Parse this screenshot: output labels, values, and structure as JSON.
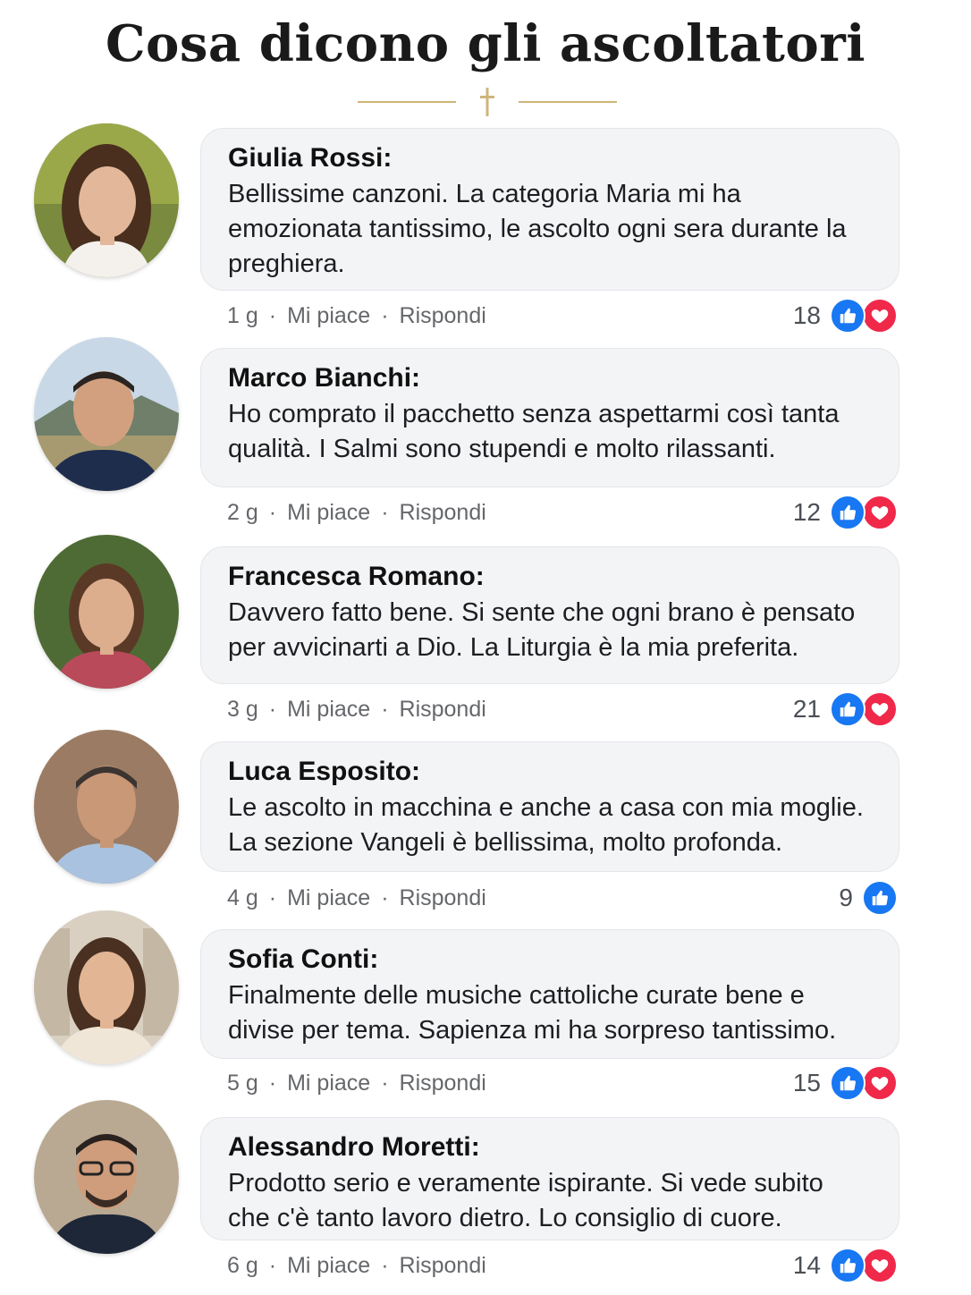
{
  "header": {
    "title": "Cosa dicono gli ascoltatori"
  },
  "colors": {
    "accent_gold": "#cfb57a",
    "like_blue": "#1877f2",
    "love_red": "#f02849",
    "bubble_bg": "#f3f4f6",
    "meta_gray": "#65676b"
  },
  "icons": {
    "divider": "cross-icon",
    "like": "thumbs-up-icon",
    "love": "heart-icon"
  },
  "meta_labels": {
    "like": "Mi piace",
    "reply": "Rispondi",
    "separator": "·"
  },
  "comments": [
    {
      "author": "Giulia Rossi:",
      "text": "Bellissime canzoni. La categoria Maria mi ha emozionata tantissimo, le ascolto ogni sera durante la preghiera.",
      "time": "1 g",
      "count": "18",
      "reactions": [
        "like",
        "love"
      ]
    },
    {
      "author": "Marco Bianchi:",
      "text": "Ho comprato il pacchetto senza aspettarmi così tanta qualità. I Salmi sono stupendi e molto rilassanti.",
      "time": "2 g",
      "count": "12",
      "reactions": [
        "like",
        "love"
      ]
    },
    {
      "author": "Francesca Romano:",
      "text": "Davvero fatto bene. Si sente che ogni brano è pensato per avvicinarti a Dio. La Liturgia è la mia preferita.",
      "time": "3 g",
      "count": "21",
      "reactions": [
        "like",
        "love"
      ]
    },
    {
      "author": "Luca Esposito:",
      "text": "Le ascolto in macchina e anche a casa con mia moglie. La sezione Vangeli è bellissima, molto profonda.",
      "time": "4 g",
      "count": "9",
      "reactions": [
        "like"
      ]
    },
    {
      "author": "Sofia Conti:",
      "text": "Finalmente delle musiche cattoliche curate bene e divise per tema. Sapienza mi ha sorpreso tantissimo.",
      "time": "5 g",
      "count": "15",
      "reactions": [
        "like",
        "love"
      ]
    },
    {
      "author": "Alessandro Moretti:",
      "text": "Prodotto serio e veramente ispirante. Si vede subito che c'è tanto lavoro dietro. Lo consiglio di cuore.",
      "time": "6 g",
      "count": "14",
      "reactions": [
        "like",
        "love"
      ]
    }
  ]
}
